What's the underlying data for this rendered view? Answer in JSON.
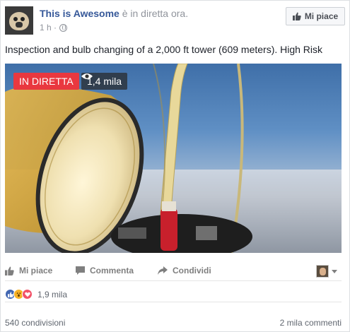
{
  "post": {
    "author_name": "This is Awesome",
    "author_status": " è in diretta ora.",
    "time": "1 h ·",
    "text": "Inspection and bulb changing of a 2,000 ft tower (609 meters). High Risk",
    "like_page_label": "Mi piace"
  },
  "video": {
    "live_label": "IN DIRETTA",
    "viewers": "1,4 mila"
  },
  "actions": {
    "like": "Mi piace",
    "comment": "Commenta",
    "share": "Condividi"
  },
  "stats": {
    "reactions_count": "1,9 mila",
    "shares": "540 condivisioni",
    "comments": "2 mila commenti"
  },
  "colors": {
    "link_blue": "#365899",
    "live_red": "#e9383f",
    "like_blue": "#4267b2"
  }
}
